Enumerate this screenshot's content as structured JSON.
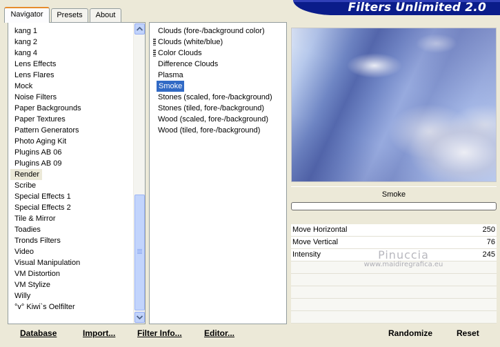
{
  "app": {
    "title": "Filters Unlimited 2.0"
  },
  "tabs": [
    {
      "label": "Navigator",
      "active": true
    },
    {
      "label": "Presets",
      "active": false
    },
    {
      "label": "About",
      "active": false
    }
  ],
  "categories": {
    "selected": "Render",
    "items": [
      "kang 1",
      "kang 2",
      "kang 4",
      "Lens Effects",
      "Lens Flares",
      "Mock",
      "Noise Filters",
      "Paper Backgrounds",
      "Paper Textures",
      "Pattern Generators",
      "Photo Aging Kit",
      "Plugins AB 06",
      "Plugins AB 09",
      "Render",
      "Scribe",
      "Special Effects 1",
      "Special Effects 2",
      "Tile & Mirror",
      "Toadies",
      "Tronds Filters",
      "Video",
      "Visual Manipulation",
      "VM Distortion",
      "VM Stylize",
      "Willy",
      "°v° Kiwi`s Oelfilter"
    ]
  },
  "filters": {
    "selected": "Smoke",
    "items": [
      {
        "label": "Clouds (fore-/background color)",
        "mark": false
      },
      {
        "label": "Clouds (white/blue)",
        "mark": true
      },
      {
        "label": "Color Clouds",
        "mark": true
      },
      {
        "label": "Difference Clouds",
        "mark": false
      },
      {
        "label": "Plasma",
        "mark": false
      },
      {
        "label": "Smoke",
        "mark": false
      },
      {
        "label": "Stones (scaled, fore-/background)",
        "mark": false
      },
      {
        "label": "Stones (tiled, fore-/background)",
        "mark": false
      },
      {
        "label": "Wood (scaled, fore-/background)",
        "mark": false
      },
      {
        "label": "Wood (tiled, fore-/background)",
        "mark": false
      }
    ]
  },
  "preview": {
    "filter_name": "Smoke",
    "progress_fraction": 0.0
  },
  "params": [
    {
      "label": "Move Horizontal",
      "value": "250"
    },
    {
      "label": "Move Vertical",
      "value": "76"
    },
    {
      "label": "Intensity",
      "value": "245"
    }
  ],
  "watermark": {
    "name": "Pinuccia",
    "site": "www.maidiregrafica.eu"
  },
  "buttons": {
    "database": "Database",
    "import": "Import...",
    "filter_info": "Filter Info...",
    "editor": "Editor...",
    "randomize": "Randomize",
    "reset": "Reset"
  },
  "colors": {
    "selection": "#316ac5",
    "banner": "#0a1c8a",
    "tab_accent": "#e68b2c"
  }
}
